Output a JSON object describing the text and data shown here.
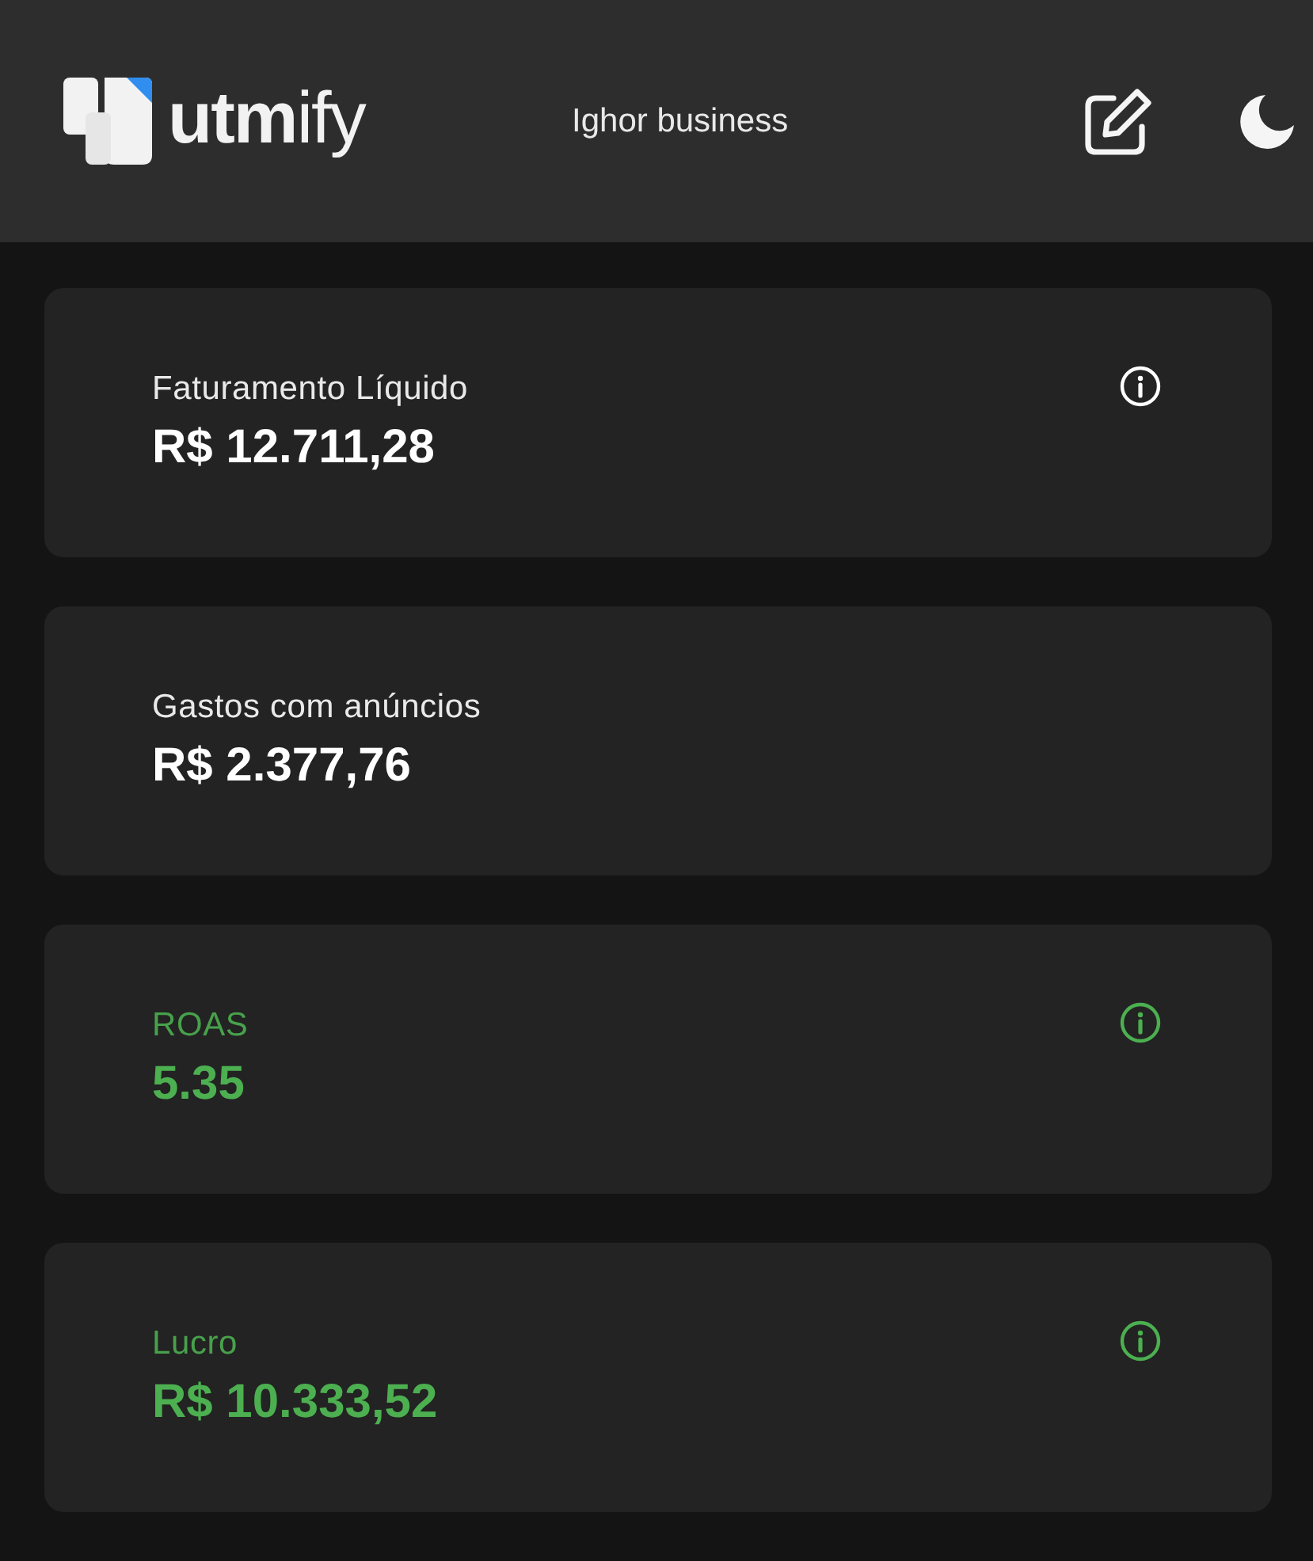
{
  "header": {
    "logo": "**utm**ify",
    "account": "Ighor business"
  },
  "cards": [
    {
      "label": "Faturamento Líquido",
      "value": "R$ 12.711,28",
      "color": "#ffffff",
      "info": true
    },
    {
      "label": "Gastos com anúncios",
      "value": "R$ 2.377,76",
      "color": "#ffffff",
      "info": false
    },
    {
      "label": "ROAS",
      "value": "5.35",
      "color": "#4caf50",
      "info": true
    },
    {
      "label": "Lucro",
      "value": "R$ 10.333,52",
      "color": "#4caf50",
      "info": true
    }
  ]
}
